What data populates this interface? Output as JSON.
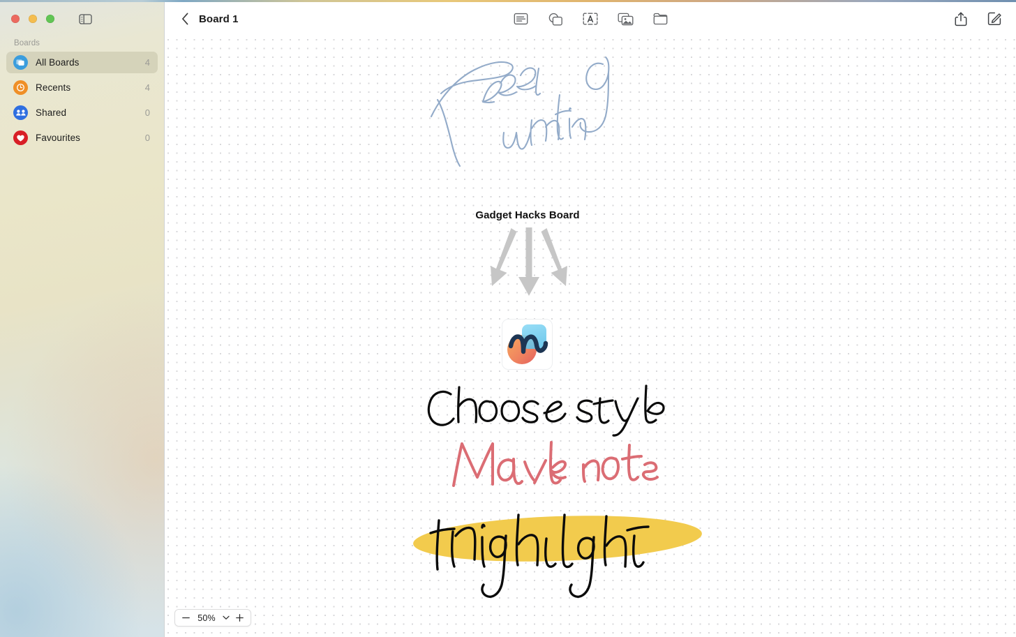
{
  "window": {
    "traffic_lights": [
      "close",
      "minimize",
      "zoom"
    ],
    "sidebar_toggle_label": "Toggle Sidebar"
  },
  "sidebar": {
    "section_label": "Boards",
    "items": [
      {
        "label": "All Boards",
        "count": "4",
        "icon": "boards-icon",
        "selected": true
      },
      {
        "label": "Recents",
        "count": "4",
        "icon": "clock-icon",
        "selected": false
      },
      {
        "label": "Shared",
        "count": "0",
        "icon": "people-icon",
        "selected": false
      },
      {
        "label": "Favourites",
        "count": "0",
        "icon": "heart-icon",
        "selected": false
      }
    ]
  },
  "toolbar": {
    "back_label": "Back",
    "title": "Board 1",
    "tools": [
      {
        "name": "sticky-note-icon",
        "label": "Sticky Note"
      },
      {
        "name": "shapes-icon",
        "label": "Shapes"
      },
      {
        "name": "text-box-icon",
        "label": "Text Box"
      },
      {
        "name": "media-icon",
        "label": "Media"
      },
      {
        "name": "insert-file-icon",
        "label": "Insert File"
      }
    ],
    "share_label": "Share",
    "compose_label": "New Board"
  },
  "canvas": {
    "board_heading": "Gadget Hacks Board",
    "strokes": [
      {
        "name": "free-writing-stroke",
        "text": "Free writing",
        "color": "#8ea7c8",
        "style": "thin-pen"
      },
      {
        "name": "choose-style-stroke",
        "text": "Choose style",
        "color": "#000000",
        "style": "pen"
      },
      {
        "name": "make-notes-stroke",
        "text": "Make notes",
        "color": "#d9626a",
        "style": "crayon"
      },
      {
        "name": "highlight-stroke",
        "text": "Highlight",
        "color": "#000000",
        "style": "pen"
      }
    ],
    "highlighter_color": "#f2cb4d",
    "arrows_color": "#c6c6c6",
    "app_icon": {
      "name": "freeform-app-icon",
      "circle_color": "#f08a5d",
      "square_color": "#7fd4f2",
      "squiggle_color": "#1c3553"
    }
  },
  "zoom": {
    "minus_label": "Zoom Out",
    "value": "50%",
    "plus_label": "Zoom In",
    "chevron_label": "Zoom Options"
  }
}
